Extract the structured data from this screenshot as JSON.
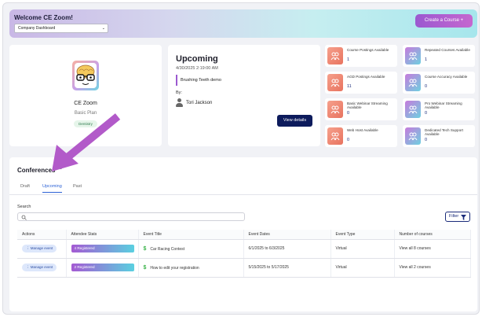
{
  "header": {
    "welcome": "Welcome CE Zoom!",
    "dashboard_select": "Company Dashboard",
    "create_button": "Create a Course +"
  },
  "profile": {
    "name": "CE Zoom",
    "plan": "Basic Plan",
    "tag": "Dentistry"
  },
  "upcoming": {
    "title": "Upcoming",
    "datetime": "4/30/2025 2:19:00 AM",
    "event": "Brushing Teeth demo",
    "by_label": "By:",
    "presenter": "Tori Jackson",
    "view_button": "View details"
  },
  "stats": [
    {
      "label": "Course Postings Available",
      "value": "1",
      "color": "orange"
    },
    {
      "label": "Repeated Courses Available",
      "value": "1",
      "color": "purple"
    },
    {
      "label": "AGD Postings Available",
      "value": "11",
      "color": "orange"
    },
    {
      "label": "Course Accuracy Available",
      "value": "0",
      "color": "purple"
    },
    {
      "label": "Basic Webinar Streaming Available",
      "value": "0",
      "color": "orange"
    },
    {
      "label": "Pro Webinar Streaming Available",
      "value": "0",
      "color": "purple"
    },
    {
      "label": "Web Host Available",
      "value": "0",
      "color": "orange"
    },
    {
      "label": "Dedicated Tech Support Available",
      "value": "0",
      "color": "purple"
    }
  ],
  "conferences": {
    "title": "Conferences",
    "tabs": [
      "Draft",
      "Upcoming",
      "Past"
    ],
    "active_tab": "Upcoming",
    "search_label": "Search",
    "search_placeholder": "",
    "filter_button": "Filter",
    "columns": [
      "Actions",
      "Attendee Stats",
      "Event Title",
      "Event Dates",
      "Event Type",
      "Number of courses"
    ],
    "rows": [
      {
        "action": "Manage event",
        "attendees": "4 Registered",
        "title": "Car Racing Contest",
        "dates": "6/1/2025 to 6/3/2025",
        "type": "Virtual",
        "courses": "View all 8 courses"
      },
      {
        "action": "Manage event",
        "attendees": "2 Registered",
        "title": "How to edit your registration",
        "dates": "5/15/2025 to 5/17/2025",
        "type": "Virtual",
        "courses": "View all 2 courses"
      }
    ]
  },
  "colors": {
    "accent_purple": "#9b59d0",
    "navy": "#0d1b5c",
    "tab_blue": "#2e63d6",
    "arrow": "#b25ac9"
  }
}
